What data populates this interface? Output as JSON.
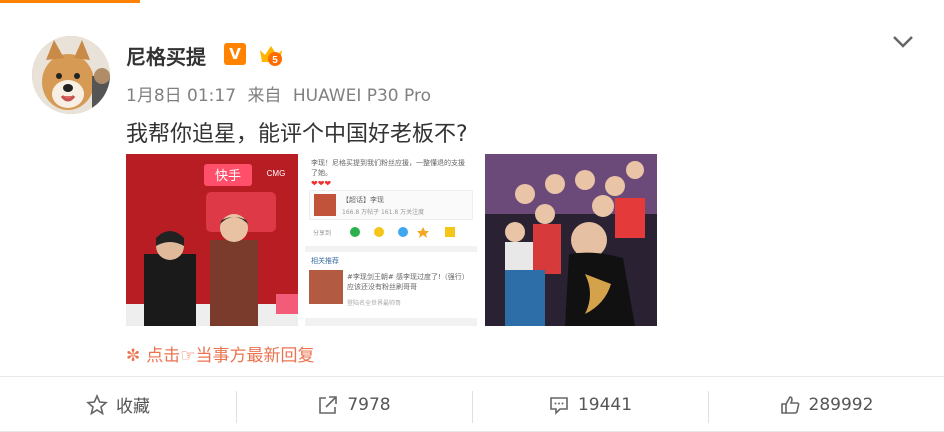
{
  "post": {
    "author": "尼格买提",
    "verified_badge": "V",
    "level_badge": "5",
    "date": "1月8日 01:17",
    "source_prefix": "来自",
    "source": "HUAWEI P30 Pro",
    "text": "我帮你追星，能评个中国好老板不?",
    "reply_link": "点击☞当事方最新回复",
    "accent_color": "#ff8200",
    "link_color": "#eb7350"
  },
  "images": {
    "photo1": {
      "logo": "快手",
      "banner_text": "CMG"
    },
    "photo2": {
      "top_text": "李现！尼格买提到我们粉丝应援，一整懂退的支援了她。",
      "hearts": "❤❤❤",
      "card_title": "【超话】李现",
      "card_sub": "166.8 万帖子 161.8 万关注度",
      "share_label": "分享到",
      "related_title": "相关推荐",
      "related_text": "#李现剑王朝# 感李现过度了!（强行）应该还没有粉丝刷哥哥",
      "related_sub": "登陆名全世界最帅哥"
    }
  },
  "actions": [
    {
      "label": "收藏",
      "icon": "star-icon"
    },
    {
      "label": "7978",
      "icon": "share-icon"
    },
    {
      "label": "19441",
      "icon": "comment-icon"
    },
    {
      "label": "289992",
      "icon": "like-icon"
    }
  ]
}
